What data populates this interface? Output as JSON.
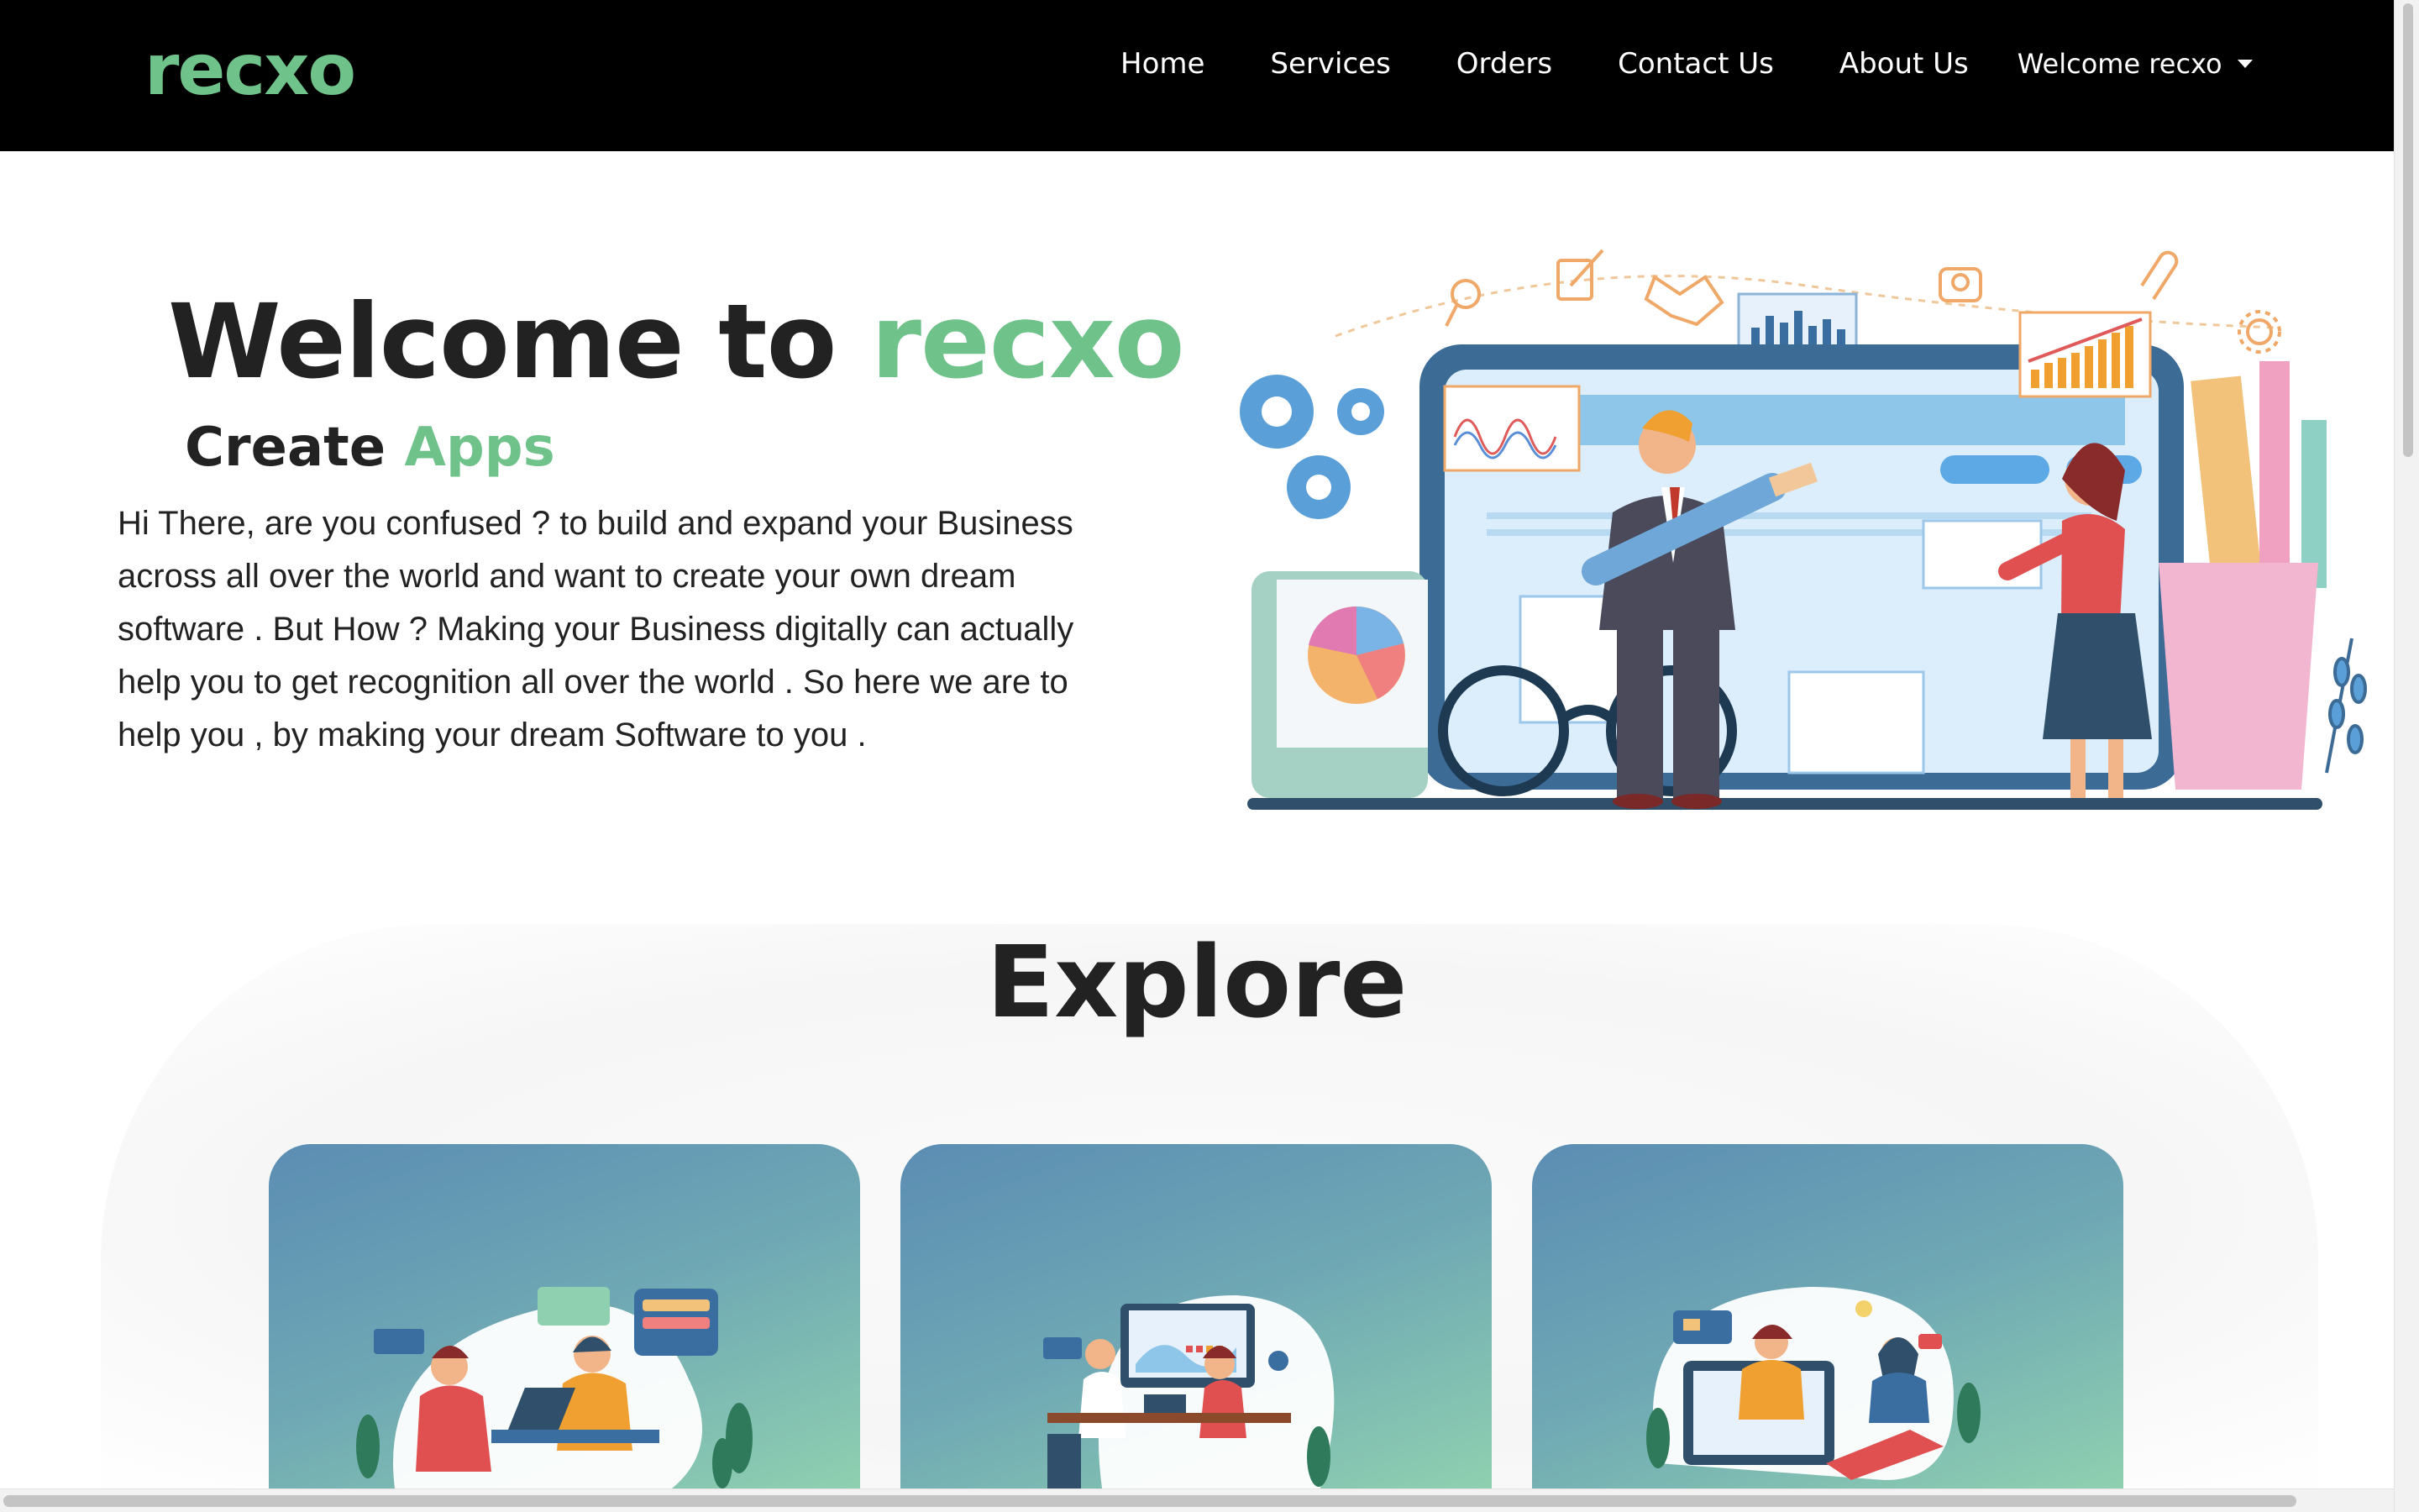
{
  "brand": {
    "logo": "recxo"
  },
  "nav": {
    "links": [
      "Home",
      "Services",
      "Orders",
      "Contact Us",
      "About Us"
    ],
    "user_menu": "Welcome recxo"
  },
  "hero": {
    "title_prefix": "Welcome to",
    "title_accent": "recxo",
    "subtitle_prefix": "Create",
    "subtitle_accent": "Apps",
    "body": "Hi There, are you confused ? to build and expand your Business across all over the world and want to create your own dream software . But How ? Making your Business digitally can actually help you to get recognition all over the world . So here we are to help you , by making your dream Software to you ."
  },
  "explore": {
    "title": "Explore",
    "cards": [
      {
        "illustration": "team-collaboration-illustration"
      },
      {
        "illustration": "meeting-dashboard-illustration"
      },
      {
        "illustration": "video-call-support-illustration"
      }
    ]
  },
  "colors": {
    "accent": "#6ec28a",
    "nav_bg": "#000000",
    "card_gradient_start": "#5b8db3",
    "card_gradient_end": "#8fd0b0"
  }
}
